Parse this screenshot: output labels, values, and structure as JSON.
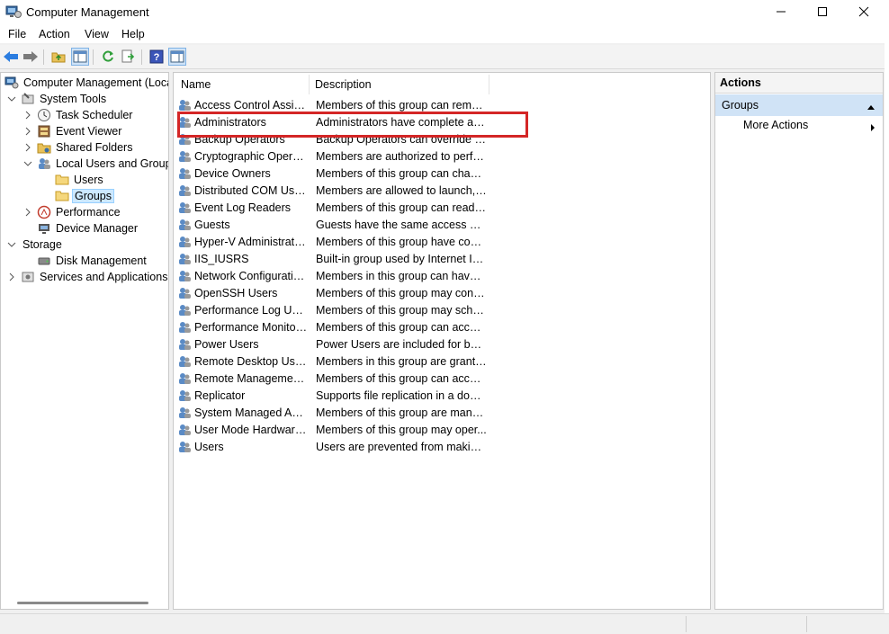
{
  "window": {
    "title": "Computer Management",
    "controls": {
      "minimize": "—",
      "maximize": "☐",
      "close": "✕"
    }
  },
  "menu": [
    "File",
    "Action",
    "View",
    "Help"
  ],
  "toolbar": {
    "buttons": [
      "back-icon",
      "forward-icon",
      "up-folder-icon",
      "show-hide-tree-icon",
      "refresh-icon",
      "export-list-icon",
      "help-icon",
      "show-hide-action-pane-icon"
    ]
  },
  "tree": {
    "items": [
      {
        "label": "Computer Management (Local",
        "indent": 0
      },
      {
        "label": "System Tools",
        "indent": 1
      },
      {
        "label": "Task Scheduler",
        "indent": 2
      },
      {
        "label": "Event Viewer",
        "indent": 2
      },
      {
        "label": "Shared Folders",
        "indent": 2
      },
      {
        "label": "Local Users and Groups",
        "indent": 2
      },
      {
        "label": "Users",
        "indent": 3
      },
      {
        "label": "Groups",
        "indent": 3
      },
      {
        "label": "Performance",
        "indent": 2
      },
      {
        "label": "Device Manager",
        "indent": 2
      },
      {
        "label": "Storage",
        "indent": 1
      },
      {
        "label": "Disk Management",
        "indent": 2
      },
      {
        "label": "Services and Applications",
        "indent": 1
      }
    ]
  },
  "list": {
    "columns": {
      "name": "Name",
      "description": "Description"
    },
    "rows": [
      {
        "name": "Access Control Assist...",
        "description": "Members of this group can remot..."
      },
      {
        "name": "Administrators",
        "description": "Administrators have complete an..."
      },
      {
        "name": "Backup Operators",
        "description": "Backup Operators can override se..."
      },
      {
        "name": "Cryptographic Operat...",
        "description": "Members are authorized to perfor..."
      },
      {
        "name": "Device Owners",
        "description": "Members of this group can chang..."
      },
      {
        "name": "Distributed COM Users",
        "description": "Members are allowed to launch, a..."
      },
      {
        "name": "Event Log Readers",
        "description": "Members of this group can read e..."
      },
      {
        "name": "Guests",
        "description": "Guests have the same access as m..."
      },
      {
        "name": "Hyper-V Administrators",
        "description": "Members of this group have com..."
      },
      {
        "name": "IIS_IUSRS",
        "description": "Built-in group used by Internet Inf..."
      },
      {
        "name": "Network Configuratio...",
        "description": "Members in this group can have s..."
      },
      {
        "name": "OpenSSH Users",
        "description": "Members of this group may conn..."
      },
      {
        "name": "Performance Log Users",
        "description": "Members of this group may sche..."
      },
      {
        "name": "Performance Monitor ...",
        "description": "Members of this group can acces..."
      },
      {
        "name": "Power Users",
        "description": "Power Users are included for back..."
      },
      {
        "name": "Remote Desktop Users",
        "description": "Members in this group are grante..."
      },
      {
        "name": "Remote Management...",
        "description": "Members of this group can acces..."
      },
      {
        "name": "Replicator",
        "description": "Supports file replication in a dom..."
      },
      {
        "name": "System Managed Acc...",
        "description": "Members of this group are mana..."
      },
      {
        "name": "User Mode Hardware ...",
        "description": "Members of this group may oper..."
      },
      {
        "name": "Users",
        "description": "Users are prevented from making ..."
      }
    ]
  },
  "actions": {
    "header": "Actions",
    "group": "Groups",
    "more": "More Actions"
  },
  "colors": {
    "highlight": "#d42626",
    "selection": "#cce8ff",
    "actions_group": "#d0e3f6"
  }
}
